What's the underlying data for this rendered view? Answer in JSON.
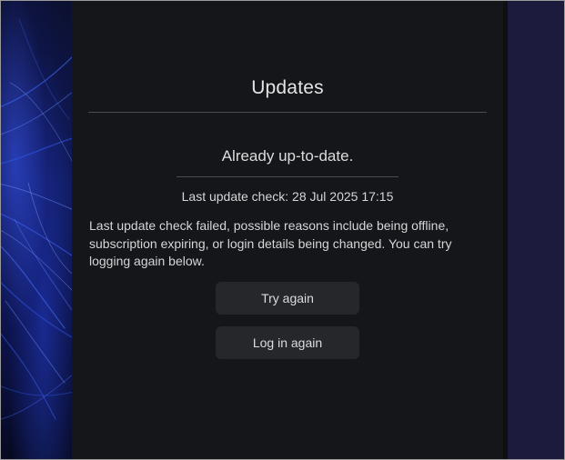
{
  "updates": {
    "title": "Updates",
    "status": "Already up-to-date.",
    "last_check": "Last update check: 28 Jul 2025 17:15",
    "message": "Last update check failed, possible reasons include being offline, subscription expiring, or login details being changed. You can try logging again below.",
    "try_again_label": "Try again",
    "log_in_again_label": "Log in again"
  },
  "colors": {
    "panel_background": "#151619",
    "button_background": "#26272b",
    "text": "#dcdcdf",
    "divider": "#4b4c50",
    "right_strip": "#1c1a3d"
  }
}
